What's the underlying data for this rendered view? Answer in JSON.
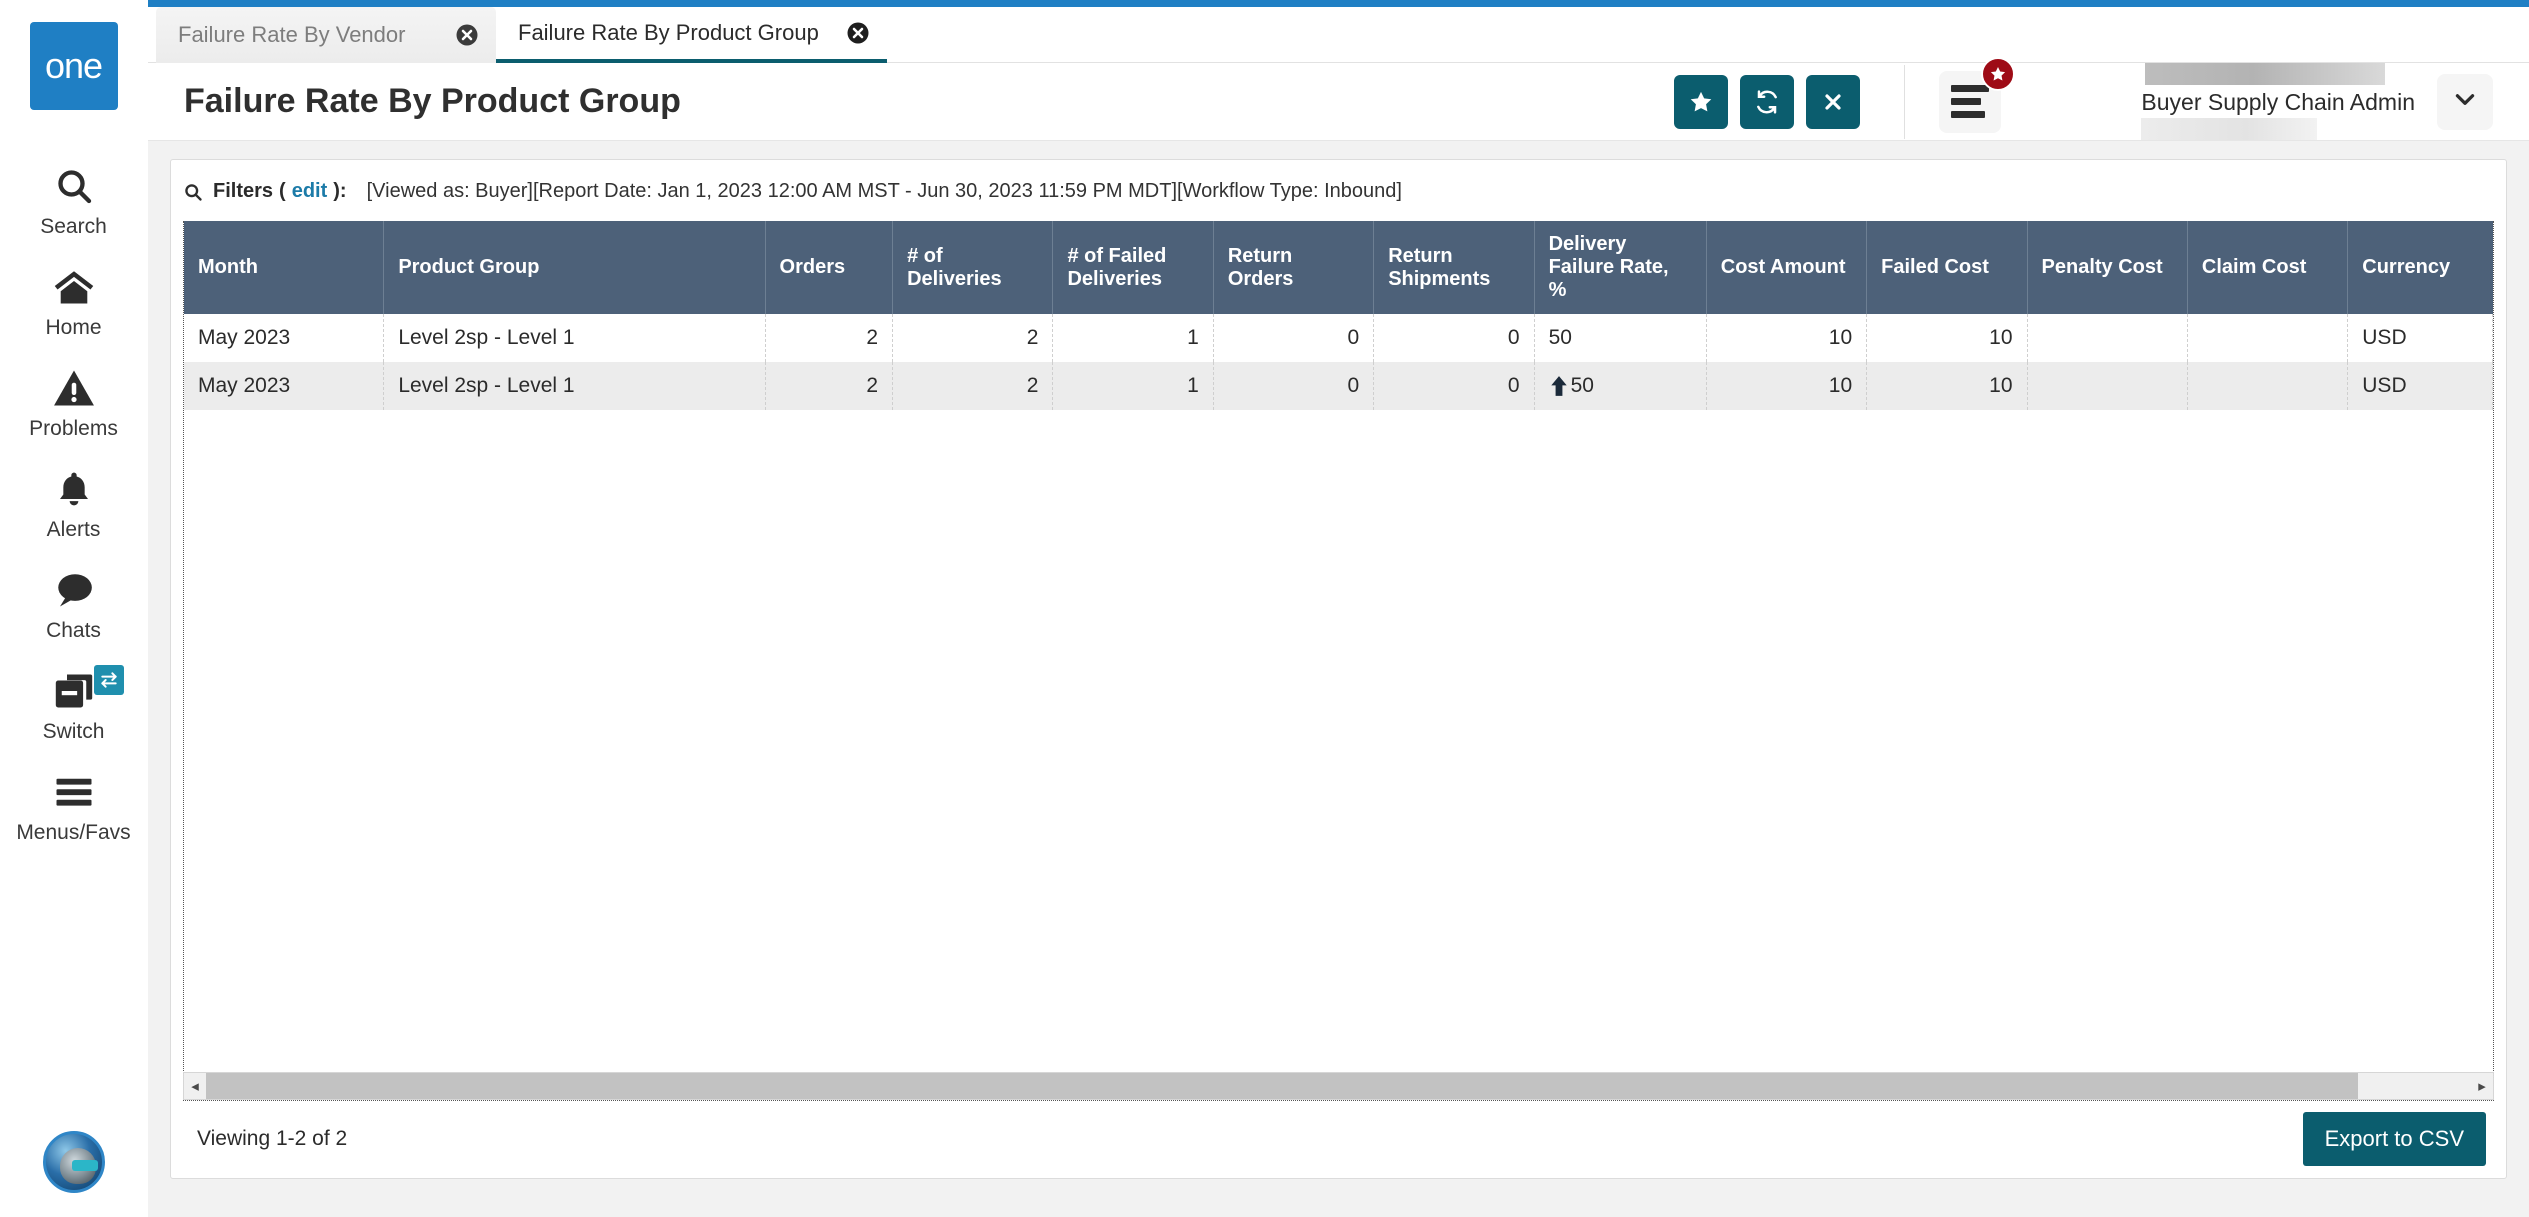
{
  "brand": {
    "logo_text": "one",
    "logo_color": "#1f7fc4"
  },
  "sidebar": {
    "items": [
      {
        "label": "Search",
        "icon": "search-icon"
      },
      {
        "label": "Home",
        "icon": "home-icon"
      },
      {
        "label": "Problems",
        "icon": "warning-triangle-icon"
      },
      {
        "label": "Alerts",
        "icon": "bell-icon"
      },
      {
        "label": "Chats",
        "icon": "chat-bubble-icon"
      },
      {
        "label": "Switch",
        "icon": "switch-windows-icon"
      },
      {
        "label": "Menus/Favs",
        "icon": "hamburger-icon"
      }
    ]
  },
  "tabs": [
    {
      "label": "Failure Rate By Vendor",
      "active": false
    },
    {
      "label": "Failure Rate By Product Group",
      "active": true
    }
  ],
  "header": {
    "title": "Failure Rate By Product Group",
    "actions": [
      {
        "name": "favorite-button",
        "icon": "star-icon",
        "color": "#0b5d6e"
      },
      {
        "name": "refresh-button",
        "icon": "refresh-icon",
        "color": "#0b5d6e"
      },
      {
        "name": "close-button",
        "icon": "x-icon",
        "color": "#0b5d6e"
      }
    ],
    "menus_button": {
      "icon": "menu-lines-icon",
      "badge_icon": "star-icon",
      "badge_color": "#9e0b16"
    },
    "user": {
      "name": "Buyer Supply Chain Admin",
      "caret": "chevron-down-icon"
    }
  },
  "filters": {
    "icon": "search-icon",
    "label": "Filters",
    "open_paren": "(",
    "edit_link": "edit",
    "close_paren": "):",
    "summary": "[Viewed as: Buyer][Report Date: Jan 1, 2023 12:00 AM MST - Jun 30, 2023 11:59 PM MDT][Workflow Type: Inbound]"
  },
  "table": {
    "columns": [
      "Month",
      "Product Group",
      "Orders",
      "# of Deliveries",
      "# of Failed Deliveries",
      "Return Orders",
      "Return Shipments",
      "Delivery Failure Rate, %",
      "Cost Amount",
      "Failed Cost",
      "Penalty Cost",
      "Claim Cost",
      "Currency"
    ],
    "rows": [
      {
        "month": "May 2023",
        "product_group": "Level 2sp - Level 1",
        "orders": "2",
        "deliveries": "2",
        "failed_deliveries": "1",
        "return_orders": "0",
        "return_shipments": "0",
        "failure_rate": "50",
        "failure_rate_trend": "",
        "cost_amount": "10",
        "failed_cost": "10",
        "penalty_cost": "",
        "claim_cost": "",
        "currency": "USD"
      },
      {
        "month": "May 2023",
        "product_group": "Level 2sp - Level 1",
        "orders": "2",
        "deliveries": "2",
        "failed_deliveries": "1",
        "return_orders": "0",
        "return_shipments": "0",
        "failure_rate": "50",
        "failure_rate_trend": "up-arrow-icon",
        "cost_amount": "10",
        "failed_cost": "10",
        "penalty_cost": "",
        "claim_cost": "",
        "currency": "USD"
      }
    ]
  },
  "footer": {
    "viewing": "Viewing 1-2 of 2",
    "export_label": "Export to CSV",
    "export_color": "#0b5d6e"
  },
  "scroll": {
    "left_arrow": "◂",
    "right_arrow": "▸"
  }
}
